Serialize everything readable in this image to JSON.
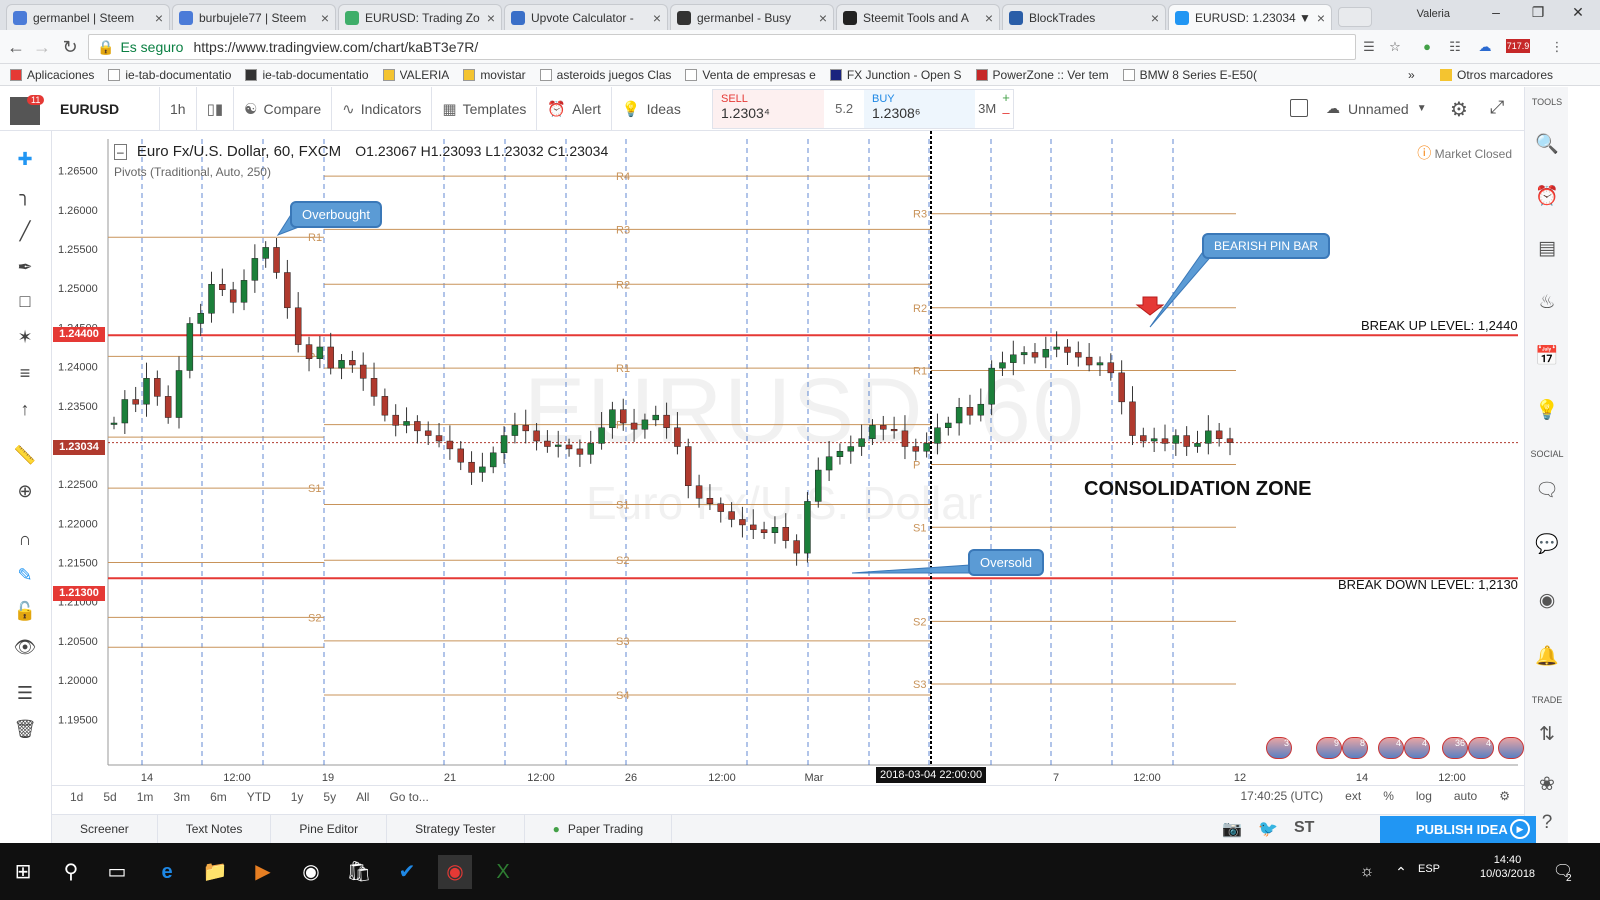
{
  "browser": {
    "tabs": [
      {
        "label": "germanbel | Steem",
        "icon": "steem-icon",
        "color": "#4b7bd8"
      },
      {
        "label": "burbujele77 | Steem",
        "icon": "steem-icon",
        "color": "#4b7bd8"
      },
      {
        "label": "EURUSD: Trading Zo",
        "icon": "green-circle-icon",
        "color": "#3fae6a"
      },
      {
        "label": "Upvote Calculator -",
        "icon": "doc-icon",
        "color": "#3a6fc8"
      },
      {
        "label": "germanbel - Busy",
        "icon": "bolt-icon",
        "color": "#333333"
      },
      {
        "label": "Steemit Tools and A",
        "icon": "h-icon",
        "color": "#222222"
      },
      {
        "label": "BlockTrades",
        "icon": "blocktrades-icon",
        "color": "#2a5ea8"
      },
      {
        "label": "EURUSD: 1.23034 ▼",
        "icon": "tradingview-icon",
        "color": "#2196f3",
        "active": true
      }
    ],
    "user": "Valeria",
    "secure_label": "Es seguro",
    "url": "https://www.tradingview.com/chart/kaBT3e7R/",
    "ext_badge": "717.9",
    "bookmarks": [
      "Aplicaciones",
      "ie-tab-documentatio",
      "ie-tab-documentatio",
      "VALERIA",
      "movistar",
      "asteroids juegos Clas",
      "Venta de empresas e",
      "FX Junction - Open S",
      "PowerZone :: Ver tem",
      "BMW 8 Series E-E50("
    ],
    "bookmarks_more": "»",
    "other_bookmarks": "Otros marcadores"
  },
  "toolbar": {
    "notification_count": "11",
    "symbol": "EURUSD",
    "interval": "1h",
    "compare": "Compare",
    "indicators": "Indicators",
    "templates": "Templates",
    "alert": "Alert",
    "ideas": "Ideas",
    "sell_label": "SELL",
    "sell_price": "1.2303⁴",
    "spread": "5.2",
    "buy_label": "BUY",
    "buy_price": "1.2308⁶",
    "quantity": "3M",
    "layout_name": "Unnamed"
  },
  "right_sidebar": {
    "tools": "TOOLS",
    "social": "SOCIAL",
    "trade": "TRADE"
  },
  "chart": {
    "legend_title": "Euro Fx/U.S. Dollar, 60, FXCM",
    "ohlc": "O1.23067  H1.23093  L1.23032  C1.23034",
    "indicator": "Pivots (Traditional, Auto, 250)",
    "market_status": "Market Closed",
    "watermark_symbol": "EURUSD, 60",
    "watermark_name": "Euro Fx/U.S. Dollar",
    "callouts": {
      "overbought": "Overbought",
      "oversold": "Oversold",
      "bearish_pin_bar": "BEARISH PIN BAR"
    },
    "consolidation_label": "CONSOLIDATION ZONE",
    "break_up_label": "BREAK UP LEVEL: 1,2440",
    "break_down_label": "BREAK DOWN LEVEL: 1,2130",
    "break_up_price": "1.24400",
    "break_down_price": "1.21300",
    "last_price": "1.23034",
    "crosshair_time": "2018-03-04 22:00:00",
    "flag_counts": [
      "3",
      "9",
      "8",
      "4",
      "4",
      "36",
      "4"
    ]
  },
  "chart_data": {
    "type": "line",
    "title": "Euro Fx/U.S. Dollar, 60, FXCM",
    "ylim": [
      1.193,
      1.2675
    ],
    "y_ticks": [
      "1.26500",
      "1.26000",
      "1.25500",
      "1.25000",
      "1.24500",
      "1.24000",
      "1.23500",
      "1.23000",
      "1.22500",
      "1.22000",
      "1.21500",
      "1.21000",
      "1.20500",
      "1.20000",
      "1.19500"
    ],
    "x_ticks": [
      "14",
      "12:00",
      "19",
      "21",
      "12:00",
      "26",
      "12:00",
      "Mar",
      "7",
      "12:00",
      "12",
      "14",
      "12:00"
    ],
    "series": [
      {
        "name": "EURUSD",
        "values": [
          1.2328,
          1.2358,
          1.2352,
          1.2385,
          1.2362,
          1.2335,
          1.2395,
          1.2455,
          1.2468,
          1.2505,
          1.2498,
          1.2482,
          1.251,
          1.2538,
          1.2552,
          1.252,
          1.2475,
          1.2428,
          1.241,
          1.2425,
          1.2398,
          1.2408,
          1.2402,
          1.2385,
          1.2362,
          1.2338,
          1.2325,
          1.233,
          1.2318,
          1.2312,
          1.2305,
          1.2295,
          1.2278,
          1.2265,
          1.2272,
          1.229,
          1.2312,
          1.2325,
          1.2318,
          1.2305,
          1.2298,
          1.23,
          1.2295,
          1.2288,
          1.2302,
          1.2322,
          1.2345,
          1.2328,
          1.232,
          1.2332,
          1.2338,
          1.2322,
          1.2298,
          1.2248,
          1.2232,
          1.2225,
          1.2215,
          1.2205,
          1.2198,
          1.2192,
          1.2188,
          1.2195,
          1.2178,
          1.2162,
          1.2228,
          1.2268,
          1.2285,
          1.2292,
          1.2298,
          1.2308,
          1.2325,
          1.232,
          1.2318,
          1.2298,
          1.2292,
          1.2302,
          1.2322,
          1.2328,
          1.2348,
          1.2338,
          1.2352,
          1.2398,
          1.2405,
          1.2415,
          1.2418,
          1.2412,
          1.2422,
          1.2425,
          1.2418,
          1.2412,
          1.2402,
          1.2405,
          1.2392,
          1.2355,
          1.2312,
          1.2305,
          1.2308,
          1.2302,
          1.2312,
          1.2298,
          1.2302,
          1.2318,
          1.2308,
          1.2303
        ]
      }
    ],
    "horizontal_levels": [
      {
        "name": "Break up level",
        "value": 1.244,
        "color": "#e53935"
      },
      {
        "name": "Break down level",
        "value": 1.213,
        "color": "#e53935"
      }
    ],
    "pivot_labels": [
      "R1",
      "P",
      "S1",
      "S2",
      "R4",
      "R3",
      "R2",
      "R1",
      "P",
      "S1",
      "S2",
      "S3",
      "S4",
      "R3",
      "R2",
      "R1",
      "P",
      "S1",
      "S2",
      "S3"
    ],
    "grid": true
  },
  "range_bar": {
    "ranges": [
      "1d",
      "5d",
      "1m",
      "3m",
      "6m",
      "YTD",
      "1y",
      "5y",
      "All",
      "Go to..."
    ],
    "clock": "17:40:25 (UTC)",
    "options": [
      "ext",
      "%",
      "log",
      "auto"
    ]
  },
  "bottom_tabs": [
    "Screener",
    "Text Notes",
    "Pine Editor",
    "Strategy Tester",
    "Paper Trading"
  ],
  "publish_label": "PUBLISH IDEA",
  "taskbar": {
    "lang": "ESP",
    "time": "14:40",
    "date": "10/03/2018",
    "notifications": "2"
  },
  "colors": {
    "accent": "#2196f3",
    "candle_up": "#1b7f3a",
    "candle_down": "#b03a2e",
    "pivot": "#c8935a",
    "break_level": "#e53935"
  }
}
